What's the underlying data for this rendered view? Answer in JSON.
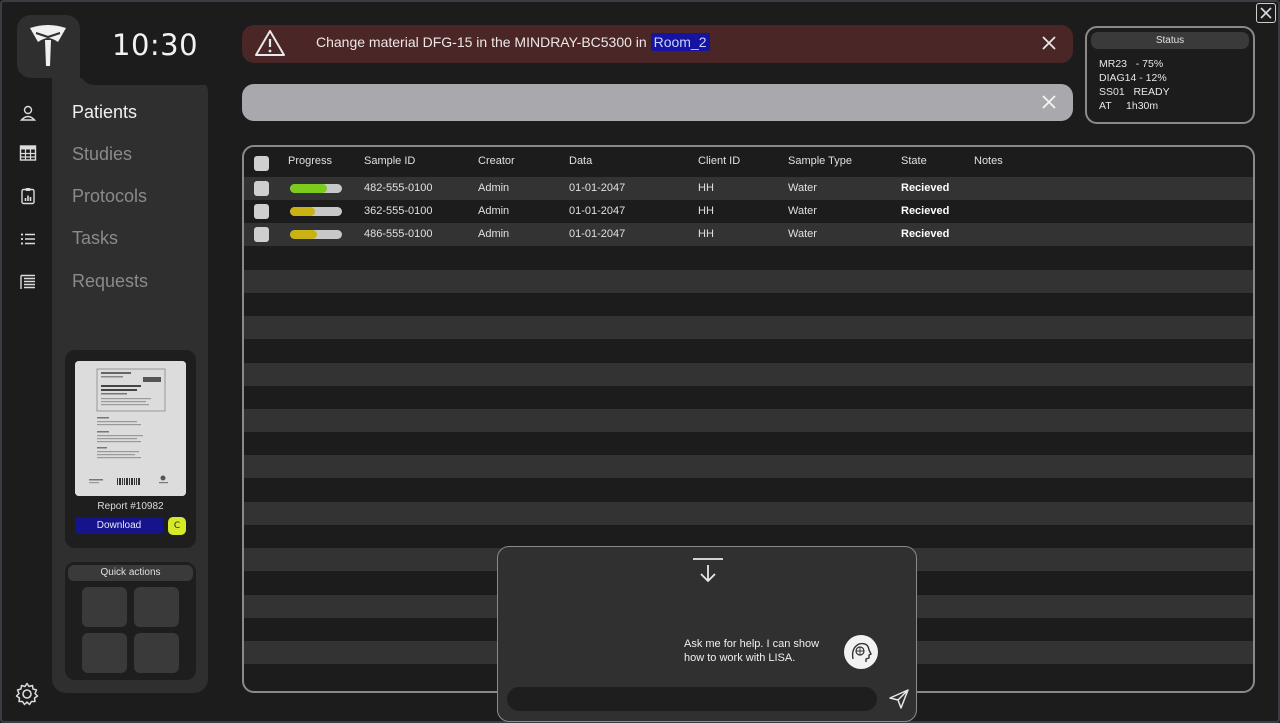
{
  "header": {
    "clock": "10:30"
  },
  "nav": {
    "items": [
      {
        "label": "Patients",
        "icon": "user-icon"
      },
      {
        "label": "Studies",
        "icon": "table-icon"
      },
      {
        "label": "Protocols",
        "icon": "clipboard-chart-icon"
      },
      {
        "label": "Tasks",
        "icon": "list-icon"
      },
      {
        "label": "Requests",
        "icon": "document-list-icon"
      }
    ],
    "active": "Patients"
  },
  "report": {
    "label": "Report #10982",
    "download_label": "Download",
    "badge": "C"
  },
  "quick_actions": {
    "title": "Quick actions"
  },
  "alert": {
    "text": "Change material DFG-15 in the MINDRAY-BC5300 in",
    "room": "Room_2"
  },
  "search": {
    "value": "",
    "placeholder": ""
  },
  "status": {
    "title": "Status",
    "lines": [
      "MR23   - 75%",
      "DIAG14 - 12%",
      "SS01   READY",
      "AT     1h30m"
    ]
  },
  "table": {
    "columns": [
      "Progress",
      "Sample ID",
      "Creator",
      "Data",
      "Client ID",
      "Sample Type",
      "State",
      "Notes"
    ],
    "rows": [
      {
        "progress": 0.72,
        "progress_color": "#7ccc1c",
        "sample_id": "482-555-0100",
        "creator": "Admin",
        "data": "01-01-2047",
        "client_id": "HH",
        "sample_type": "Water",
        "state": "Recieved",
        "notes": ""
      },
      {
        "progress": 0.48,
        "progress_color": "#c9b214",
        "sample_id": "362-555-0100",
        "creator": "Admin",
        "data": "01-01-2047",
        "client_id": "HH",
        "sample_type": "Water",
        "state": "Recieved",
        "notes": ""
      },
      {
        "progress": 0.52,
        "progress_color": "#c9b214",
        "sample_id": "486-555-0100",
        "creator": "Admin",
        "data": "01-01-2047",
        "client_id": "HH",
        "sample_type": "Water",
        "state": "Recieved",
        "notes": ""
      }
    ]
  },
  "chat": {
    "message": "Ask me for help. I can show how to work with LISA.",
    "input_value": "",
    "input_placeholder": ""
  },
  "colors": {
    "accent_blue": "#15148a",
    "alert_bg": "#4a2626",
    "badge_yellow": "#d6e82a"
  }
}
